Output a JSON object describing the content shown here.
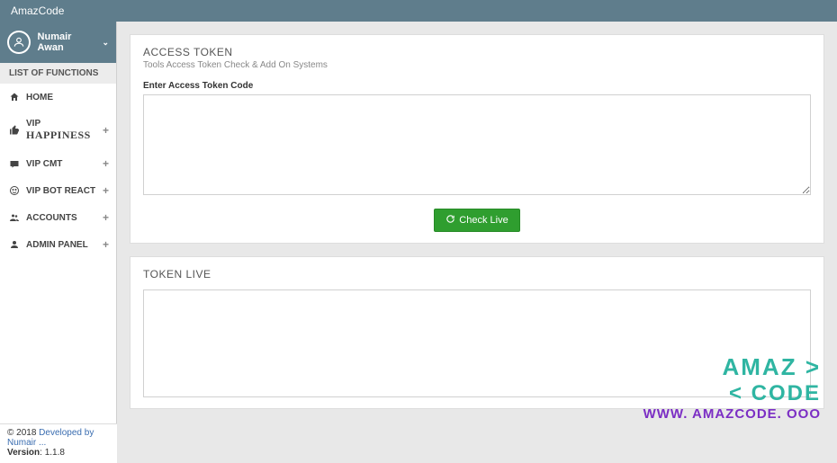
{
  "topbar": {
    "brand": "AmazCode"
  },
  "user": {
    "name": "Numair Awan"
  },
  "sidebar": {
    "header": "LIST OF FUNCTIONS",
    "items": [
      {
        "label": "HOME",
        "expandable": false
      },
      {
        "vip": "VIP",
        "extra": "HAPPINESS",
        "expandable": true
      },
      {
        "label": "VIP CMT",
        "expandable": true
      },
      {
        "label": "VIP BOT REACT",
        "expandable": true
      },
      {
        "label": "ACCOUNTS",
        "expandable": true
      },
      {
        "label": "ADMIN PANEL",
        "expandable": true
      }
    ]
  },
  "main": {
    "access_token": {
      "title": "ACCESS TOKEN",
      "subtitle": "Tools Access Token Check & Add On Systems",
      "field_label": "Enter Access Token Code",
      "textarea_value": "",
      "check_button": "Check Live"
    },
    "token_live": {
      "title": "TOKEN LIVE",
      "textarea_value": ""
    }
  },
  "watermark": {
    "line1": "AMAZ >",
    "line2": "< CODE",
    "line3": "WWW. AMAZCODE. OOO"
  },
  "footer": {
    "copyright_prefix": "© 2018 ",
    "developed_by": "Developed by Numair ...",
    "version_label": "Version",
    "version_value": ": 1.1.8"
  }
}
